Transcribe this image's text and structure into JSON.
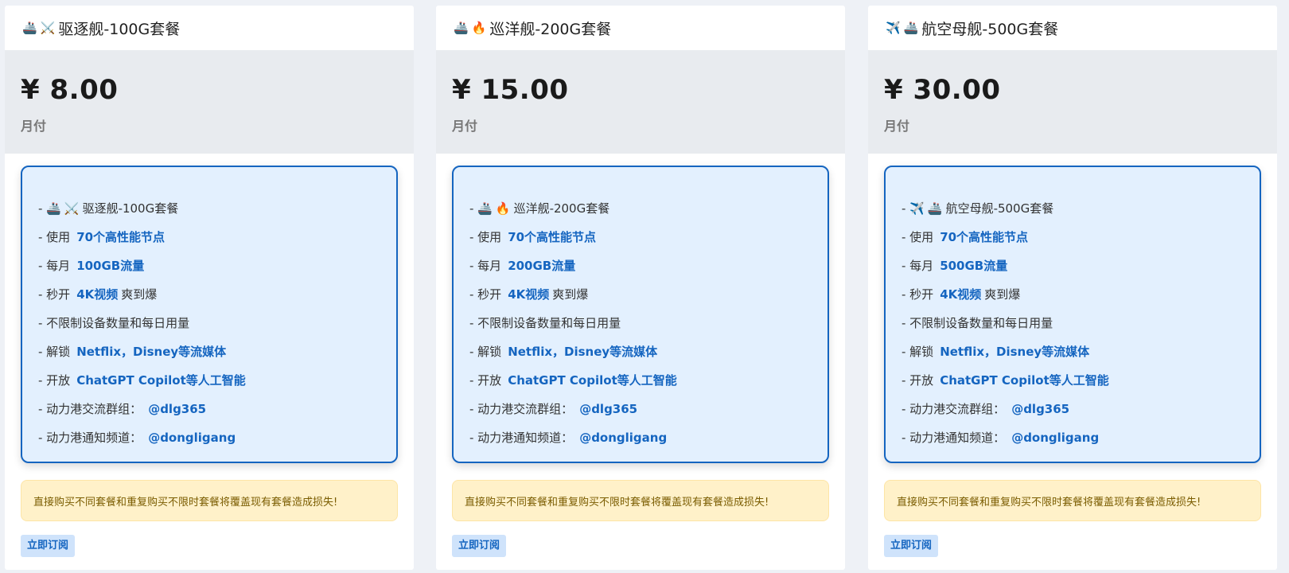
{
  "plans": [
    {
      "icons": [
        "🚢",
        "⚔️"
      ],
      "name": "驱逐舰-100G套餐",
      "price": "¥ 8.00",
      "period": "月付",
      "features": [
        {
          "prefix": "- ",
          "icons": [
            "🚢",
            "⚔️"
          ],
          "text": "驱逐舰-100G套餐"
        },
        {
          "prefix": "- 使用",
          "highlight": "70个高性能节点"
        },
        {
          "prefix": "- 每月",
          "highlight": "100GB流量"
        },
        {
          "prefix": "- 秒开",
          "highlight": "4K视频",
          "suffix": "爽到爆"
        },
        {
          "prefix": "- 不限制设备数量和每日用量"
        },
        {
          "prefix": "- 解锁",
          "highlight": "Netflix，Disney等流媒体"
        },
        {
          "prefix": "- 开放",
          "highlight": "ChatGPT Copilot等人工智能"
        },
        {
          "prefix": "- 动力港交流群组：",
          "highlight": "@dlg365"
        },
        {
          "prefix": "- 动力港通知频道：",
          "highlight": "@dongligang"
        }
      ],
      "warning": "直接购买不同套餐和重复购买不限时套餐将覆盖现有套餐造成损失!",
      "button": "立即订阅"
    },
    {
      "icons": [
        "🚢",
        "🔥"
      ],
      "name": "巡洋舰-200G套餐",
      "price": "¥ 15.00",
      "period": "月付",
      "features": [
        {
          "prefix": "- ",
          "icons": [
            "🚢",
            "🔥"
          ],
          "text": "巡洋舰-200G套餐"
        },
        {
          "prefix": "- 使用",
          "highlight": "70个高性能节点"
        },
        {
          "prefix": "- 每月",
          "highlight": "200GB流量"
        },
        {
          "prefix": "- 秒开",
          "highlight": "4K视频",
          "suffix": "爽到爆"
        },
        {
          "prefix": "- 不限制设备数量和每日用量"
        },
        {
          "prefix": "- 解锁",
          "highlight": "Netflix，Disney等流媒体"
        },
        {
          "prefix": "- 开放",
          "highlight": "ChatGPT Copilot等人工智能"
        },
        {
          "prefix": "- 动力港交流群组：",
          "highlight": "@dlg365"
        },
        {
          "prefix": "- 动力港通知频道：",
          "highlight": "@dongligang"
        }
      ],
      "warning": "直接购买不同套餐和重复购买不限时套餐将覆盖现有套餐造成损失!",
      "button": "立即订阅"
    },
    {
      "icons": [
        "✈️",
        "🚢"
      ],
      "name": "航空母舰-500G套餐",
      "price": "¥ 30.00",
      "period": "月付",
      "features": [
        {
          "prefix": "- ",
          "icons": [
            "✈️",
            "🚢"
          ],
          "text": "航空母舰-500G套餐"
        },
        {
          "prefix": "- 使用",
          "highlight": "70个高性能节点"
        },
        {
          "prefix": "- 每月",
          "highlight": "500GB流量"
        },
        {
          "prefix": "- 秒开",
          "highlight": "4K视频",
          "suffix": "爽到爆"
        },
        {
          "prefix": "- 不限制设备数量和每日用量"
        },
        {
          "prefix": "- 解锁",
          "highlight": "Netflix，Disney等流媒体"
        },
        {
          "prefix": "- 开放",
          "highlight": "ChatGPT Copilot等人工智能"
        },
        {
          "prefix": "- 动力港交流群组：",
          "highlight": "@dlg365"
        },
        {
          "prefix": "- 动力港通知频道：",
          "highlight": "@dongligang"
        }
      ],
      "warning": "直接购买不同套餐和重复购买不限时套餐将覆盖现有套餐造成损失!",
      "button": "立即订阅"
    }
  ]
}
